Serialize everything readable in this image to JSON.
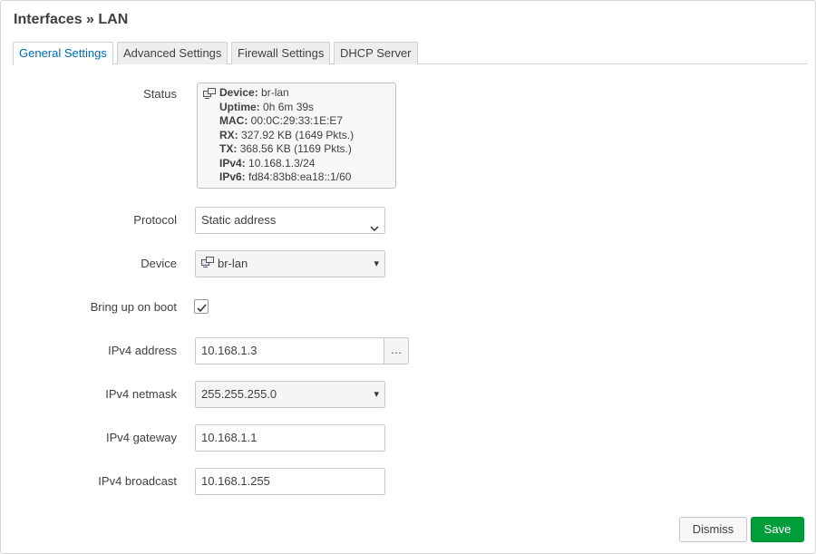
{
  "page": {
    "title": "Interfaces » LAN"
  },
  "tabs": [
    {
      "label": "General Settings",
      "active": true
    },
    {
      "label": "Advanced Settings"
    },
    {
      "label": "Firewall Settings"
    },
    {
      "label": "DHCP Server"
    }
  ],
  "status": {
    "label": "Status",
    "rows": [
      {
        "key": "Device:",
        "value": "br-lan"
      },
      {
        "key": "Uptime:",
        "value": "0h 6m 39s"
      },
      {
        "key": "MAC:",
        "value": "00:0C:29:33:1E:E7"
      },
      {
        "key": "RX:",
        "value": "327.92 KB (1649 Pkts.)"
      },
      {
        "key": "TX:",
        "value": "368.56 KB (1169 Pkts.)"
      },
      {
        "key": "IPv4:",
        "value": "10.168.1.3/24"
      },
      {
        "key": "IPv6:",
        "value": "fd84:83b8:ea18::1/60"
      }
    ]
  },
  "protocol": {
    "label": "Protocol",
    "value": "Static address"
  },
  "device": {
    "label": "Device",
    "value": "br-lan",
    "caret": "▾"
  },
  "boot": {
    "label": "Bring up on boot",
    "checked": true
  },
  "ipv4_address": {
    "label": "IPv4 address",
    "value": "10.168.1.3",
    "more": "…"
  },
  "ipv4_netmask": {
    "label": "IPv4 netmask",
    "value": "255.255.255.0",
    "caret": "▾"
  },
  "ipv4_gateway": {
    "label": "IPv4 gateway",
    "value": "10.168.1.1"
  },
  "ipv4_broadcast": {
    "label": "IPv4 broadcast",
    "value": "10.168.1.255"
  },
  "footer": {
    "dismiss_label": "Dismiss",
    "save_label": "Save"
  },
  "colors": {
    "accent": "#0069b4",
    "save": "#009e3a"
  },
  "icons": {
    "device": "network-device-icon",
    "check": "checkmark-icon",
    "chevron": "chevron-down-icon"
  }
}
